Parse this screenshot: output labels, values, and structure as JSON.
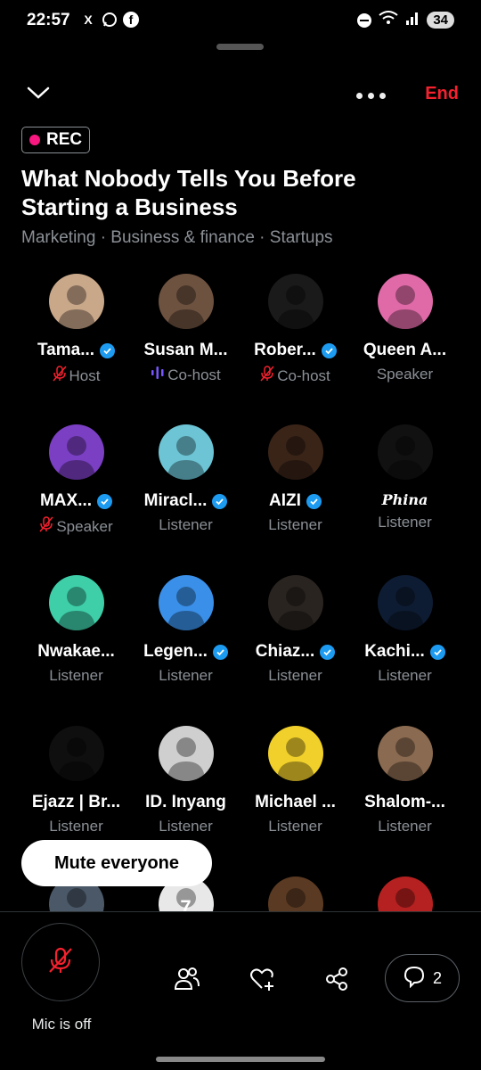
{
  "status_bar": {
    "time": "22:57",
    "battery": "34",
    "apps": [
      "X",
      "WA",
      "f"
    ]
  },
  "header": {
    "end_label": "End"
  },
  "recording": {
    "label": "REC"
  },
  "space": {
    "title": "What Nobody Tells You Before Starting a Business",
    "topics": "Marketing · Business & finance · Startups"
  },
  "participants": [
    {
      "name": "Tama...",
      "role": "Host",
      "verified": true,
      "mic": "muted",
      "color": "#c9a88a"
    },
    {
      "name": "Susan M...",
      "role": "Co-host",
      "verified": false,
      "mic": "speaking",
      "color": "#6e5240"
    },
    {
      "name": "Rober...",
      "role": "Co-host",
      "verified": true,
      "mic": "muted",
      "color": "#1a1a1a"
    },
    {
      "name": "Queen A...",
      "role": "Speaker",
      "verified": false,
      "mic": "none",
      "color": "#e06aa8"
    },
    {
      "name": "MAX...",
      "role": "Speaker",
      "verified": true,
      "mic": "muted",
      "color": "#7b3fc4"
    },
    {
      "name": "Miracl...",
      "role": "Listener",
      "verified": true,
      "mic": "none",
      "color": "#6cc4d4"
    },
    {
      "name": "AIZI",
      "role": "Listener",
      "verified": true,
      "mic": "none",
      "color": "#3a2418"
    },
    {
      "name": "Phina",
      "role": "Listener",
      "verified": false,
      "mic": "none",
      "color": "#111111",
      "script": true
    },
    {
      "name": "Nwakae...",
      "role": "Listener",
      "verified": false,
      "mic": "none",
      "color": "#3ecfa9"
    },
    {
      "name": "Legen...",
      "role": "Listener",
      "verified": true,
      "mic": "none",
      "color": "#3a8fe8"
    },
    {
      "name": "Chiaz...",
      "role": "Listener",
      "verified": true,
      "mic": "none",
      "color": "#2a2420"
    },
    {
      "name": "Kachi...",
      "role": "Listener",
      "verified": true,
      "mic": "none",
      "color": "#0e1c33"
    },
    {
      "name": "Ejazz | Br...",
      "role": "Listener",
      "verified": false,
      "mic": "none",
      "color": "#0f0f0f"
    },
    {
      "name": "ID. Inyang",
      "role": "Listener",
      "verified": false,
      "mic": "none",
      "color": "#cfcfcf"
    },
    {
      "name": "Michael ...",
      "role": "Listener",
      "verified": false,
      "mic": "none",
      "color": "#f1d02b"
    },
    {
      "name": "Shalom-...",
      "role": "Listener",
      "verified": false,
      "mic": "none",
      "color": "#8a6a50"
    },
    {
      "name": "",
      "role": "",
      "verified": false,
      "mic": "none",
      "color": "#4a5868"
    },
    {
      "name": "",
      "role": "",
      "verified": false,
      "mic": "none",
      "color": "#e8e8e8",
      "badge_text": "7"
    },
    {
      "name": "",
      "role": "",
      "verified": false,
      "mic": "none",
      "color": "#5a3a22"
    },
    {
      "name": "",
      "role": "",
      "verified": false,
      "mic": "none",
      "color": "#b52020"
    }
  ],
  "controls": {
    "mute_everyone": "Mute everyone",
    "mic_label": "Mic is off",
    "chat_count": "2"
  },
  "colors": {
    "accent_red": "#f4212e",
    "rec_dot": "#f91880",
    "verified_blue": "#1d9bf0",
    "speaking_purple": "#7856ff"
  }
}
